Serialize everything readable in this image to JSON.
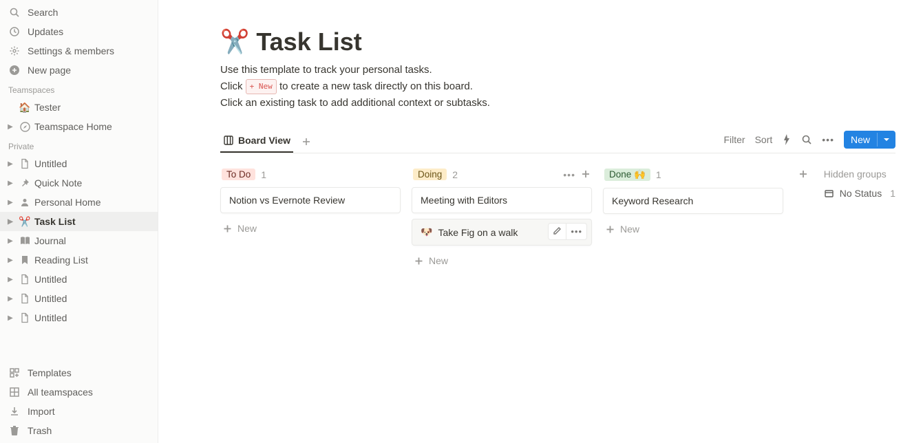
{
  "sidebar": {
    "top": [
      {
        "label": "Search",
        "icon": "search-icon"
      },
      {
        "label": "Updates",
        "icon": "clock-icon"
      },
      {
        "label": "Settings & members",
        "icon": "gear-icon"
      },
      {
        "label": "New page",
        "icon": "plus-circle-icon"
      }
    ],
    "teamspaces_label": "Teamspaces",
    "teamspaces": [
      {
        "label": "Tester",
        "icon": "🏠",
        "disclosure": false
      },
      {
        "label": "Teamspace Home",
        "icon": "compass",
        "disclosure": true
      }
    ],
    "private_label": "Private",
    "private": [
      {
        "label": "Untitled",
        "icon": "page"
      },
      {
        "label": "Quick Note",
        "icon": "pin"
      },
      {
        "label": "Personal Home",
        "icon": "person"
      },
      {
        "label": "Task List",
        "icon": "✂️",
        "active": true
      },
      {
        "label": "Journal",
        "icon": "book"
      },
      {
        "label": "Reading List",
        "icon": "bookmark"
      },
      {
        "label": "Untitled",
        "icon": "page"
      },
      {
        "label": "Untitled",
        "icon": "page"
      },
      {
        "label": "Untitled",
        "icon": "page"
      }
    ],
    "bottom": [
      {
        "label": "Templates",
        "icon": "templates-icon"
      },
      {
        "label": "All teamspaces",
        "icon": "grid-icon"
      },
      {
        "label": "Import",
        "icon": "download-icon"
      },
      {
        "label": "Trash",
        "icon": "trash-icon"
      }
    ]
  },
  "page": {
    "emoji": "✂️",
    "title": "Task List",
    "desc1": "Use this template to track your personal tasks.",
    "desc2a": "Click ",
    "desc2chip": "+ New",
    "desc2b": " to create a new task directly on this board.",
    "desc3": "Click an existing task to add additional context or subtasks."
  },
  "views": {
    "active": "Board View",
    "filter": "Filter",
    "sort": "Sort",
    "newButton": "New"
  },
  "board": {
    "columns": [
      {
        "name": "To Do",
        "tagClass": "tag-todo",
        "count": 1,
        "showActions": false,
        "cards": [
          {
            "title": "Notion vs Evernote Review"
          }
        ],
        "addLabel": "New"
      },
      {
        "name": "Doing",
        "tagClass": "tag-doing",
        "count": 2,
        "showActions": true,
        "cards": [
          {
            "title": "Meeting with Editors"
          },
          {
            "title": "Take Fig on a walk",
            "emoji": "🐶",
            "hovered": true
          }
        ],
        "addLabel": "New"
      },
      {
        "name": "Done 🙌",
        "tagClass": "tag-done",
        "count": 1,
        "showActions": false,
        "cards": [
          {
            "title": "Keyword Research"
          }
        ],
        "addLabel": "New"
      }
    ],
    "hiddenHeader": "Hidden groups",
    "hidden": [
      {
        "label": "No Status",
        "count": 1
      }
    ]
  }
}
